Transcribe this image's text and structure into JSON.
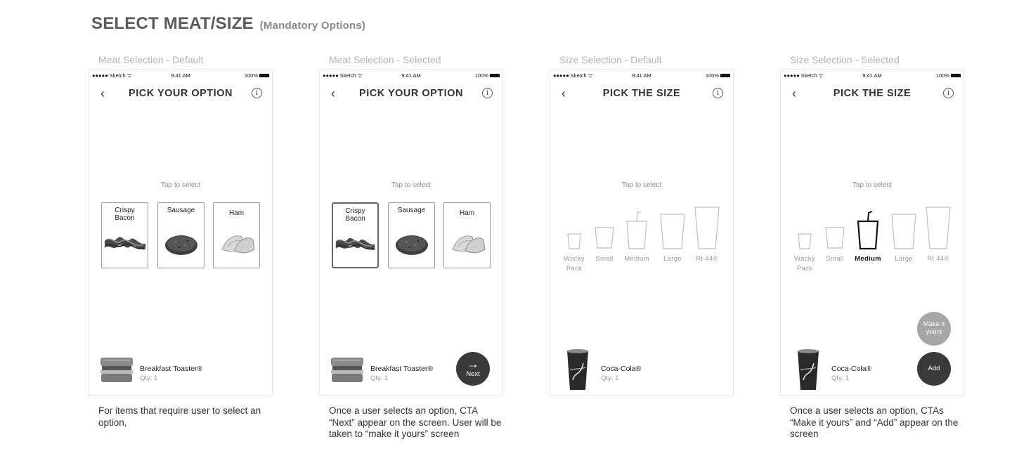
{
  "page": {
    "title": "SELECT MEAT/SIZE",
    "subtitle": "(Mandatory Options)"
  },
  "status_bar": {
    "carrier": "●●●●● Sketch ᯤ",
    "time": "9:41 AM",
    "battery": "100%"
  },
  "columns": [
    {
      "label": "Meat Selection - Default",
      "note": "For items that require user to select an option,",
      "nav_title": "PICK YOUR OPTION",
      "hint": "Tap to select",
      "options": [
        {
          "label": "Crispy Bacon",
          "selected": false
        },
        {
          "label": "Sausage",
          "selected": false
        },
        {
          "label": "Ham",
          "selected": false
        }
      ],
      "item": {
        "name": "Breakfast Toaster®",
        "qty": "Qty: 1"
      }
    },
    {
      "label": "Meat Selection - Selected",
      "note": "Once a user selects an option, CTA “Next” appear on the screen. User will be taken to “make it yours” screen",
      "nav_title": "PICK YOUR OPTION",
      "hint": "Tap to select",
      "options": [
        {
          "label": "Crispy Bacon",
          "selected": true
        },
        {
          "label": "Sausage",
          "selected": false
        },
        {
          "label": "Ham",
          "selected": false
        }
      ],
      "item": {
        "name": "Breakfast Toaster®",
        "qty": "Qty: 1"
      },
      "cta_next": "Next"
    },
    {
      "label": "Size Selection - Default",
      "note": "",
      "nav_title": "PICK THE SIZE",
      "hint": "Tap to select",
      "sizes": [
        {
          "label": "Wacky Pack",
          "selected": false
        },
        {
          "label": "Small",
          "selected": false
        },
        {
          "label": "Medium",
          "selected": false
        },
        {
          "label": "Large",
          "selected": false
        },
        {
          "label": "Rt 44®",
          "selected": false
        }
      ],
      "item": {
        "name": "Coca-Cola®",
        "qty": "Qty: 1"
      }
    },
    {
      "label": "Size Selection - Selected",
      "note": "Once a user selects an option, CTAs “Make it yours” and “Add” appear on the screen",
      "nav_title": "PICK THE SIZE",
      "hint": "Tap to select",
      "sizes": [
        {
          "label": "Wacky Pack",
          "selected": false
        },
        {
          "label": "Small",
          "selected": false
        },
        {
          "label": "Medium",
          "selected": true
        },
        {
          "label": "Large",
          "selected": false
        },
        {
          "label": "Rt 44®",
          "selected": false
        }
      ],
      "item": {
        "name": "Coca-Cola®",
        "qty": "Qty: 1"
      },
      "cta_make": "Make it yours",
      "cta_add": "Add"
    }
  ],
  "icons": {
    "back": "chevron-left-icon",
    "info": "info-icon",
    "next": "arrow-right-icon"
  },
  "info_glyph": "i",
  "back_glyph": "‹",
  "next_arrow": "→"
}
